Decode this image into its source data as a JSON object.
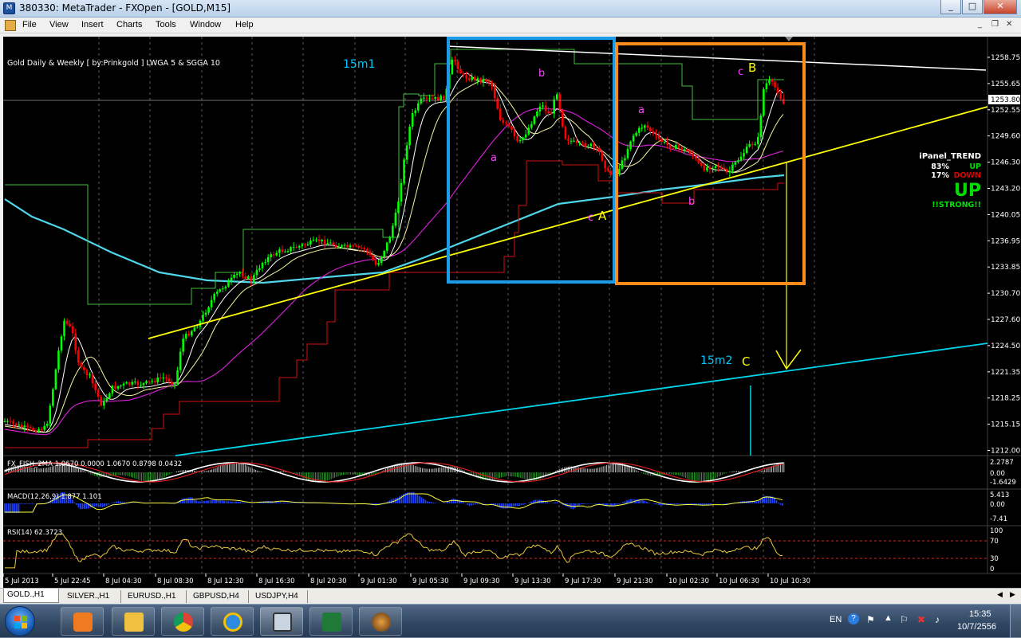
{
  "window": {
    "title": "380330: MetaTrader - FXOpen - [GOLD,M15]",
    "min": "_",
    "max": "□",
    "close": "✕"
  },
  "menu": [
    "File",
    "View",
    "Insert",
    "Charts",
    "Tools",
    "Window",
    "Help"
  ],
  "mdi": {
    "min": "_",
    "restore": "❐",
    "close": "✕"
  },
  "chart": {
    "symbol_info": "Gold Daily & Weekly [ by:Prinkgold ] LWGA 5  &  SGGA 10",
    "price_levels": [
      "1258.75",
      "1255.65",
      "1252.55",
      "1249.60",
      "1246.30",
      "1243.20",
      "1240.05",
      "1236.95",
      "1233.85",
      "1230.70",
      "1227.60",
      "1224.50",
      "1221.35",
      "1218.25",
      "1215.15",
      "1212.00"
    ],
    "current_price": "1253.80",
    "time_labels": [
      "5 Jul 2013",
      "5 Jul 22:45",
      "8 Jul 04:30",
      "8 Jul 08:30",
      "8 Jul 12:30",
      "8 Jul 16:30",
      "8 Jul 20:30",
      "9 Jul 01:30",
      "9 Jul 05:30",
      "9 Jul 09:30",
      "9 Jul 13:30",
      "9 Jul 17:30",
      "9 Jul 21:30",
      "10 Jul 02:30",
      "10 Jul 06:30",
      "10 Jul 10:30"
    ],
    "annotations": {
      "m15_1": "15m1",
      "m15_2": "15m2",
      "a1": "a",
      "b1": "b",
      "c1": "c",
      "A": "A",
      "a2": "a",
      "b2": "b",
      "c2": "c",
      "B": "B",
      "C": "C"
    },
    "ipanel": {
      "title": "iPanel_TREND",
      "up_pct": "83%",
      "up": "UP",
      "down_pct": "17%",
      "down": "DOWN",
      "big": "UP",
      "strong": "!!STRONG!!"
    },
    "colors": {
      "background": "#000000",
      "bull": "#00ff00",
      "bear": "#ff0000",
      "trend_yellow": "#ffff00",
      "trend_cyan": "#00ffff",
      "box_blue": "#1e9be6",
      "box_orange": "#ff8c1a",
      "magenta": "#ff00ff"
    }
  },
  "fisher": {
    "label": "FX_FISH_2MA 1.0670 0.0000 1.0670 0.8798 0.0432",
    "levels": [
      "2.2787",
      "0.00",
      "-1.6429"
    ]
  },
  "macd": {
    "label": "MACD(12,26,9) 1.877 1.101",
    "levels": [
      "5.413",
      "0.00",
      "-7.41"
    ]
  },
  "rsi": {
    "label": "RSI(14) 62.3723",
    "levels": [
      "100",
      "70",
      "30",
      "0"
    ]
  },
  "tabs": [
    "GOLD.,H1",
    "SILVER.,H1",
    "EURUSD.,H1",
    "GBPUSD,H4",
    "USDJPY,H4"
  ],
  "taskbar": {
    "lang": "EN",
    "time": "15:35",
    "date": "10/7/2556"
  }
}
